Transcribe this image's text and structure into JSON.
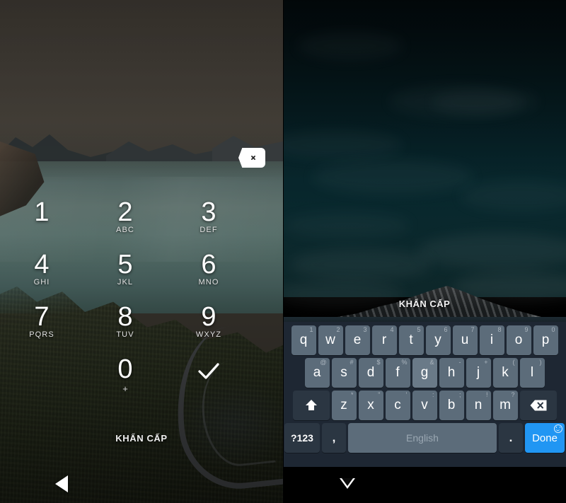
{
  "screen_left": {
    "name": "pin-lockscreen",
    "delete_key": {
      "icon": "backspace-icon",
      "label": ""
    },
    "keypad": [
      {
        "digit": "1",
        "letters": ""
      },
      {
        "digit": "2",
        "letters": "ABC"
      },
      {
        "digit": "3",
        "letters": "DEF"
      },
      {
        "digit": "4",
        "letters": "GHI"
      },
      {
        "digit": "5",
        "letters": "JKL"
      },
      {
        "digit": "6",
        "letters": "MNO"
      },
      {
        "digit": "7",
        "letters": "PQRS"
      },
      {
        "digit": "8",
        "letters": "TUV"
      },
      {
        "digit": "9",
        "letters": "WXYZ"
      },
      {
        "digit": "0",
        "letters": "+"
      }
    ],
    "enter_icon": "checkmark-icon",
    "emergency_label": "KHẨN CẤP",
    "nav_back_icon": "back-triangle-icon"
  },
  "screen_right": {
    "name": "password-lockscreen",
    "keyboard_toggle_icon": "keyboard-icon",
    "password_field": {
      "value": "",
      "placeholder": ""
    },
    "emergency_label": "KHẨN CẤP",
    "nav_down_icon": "hide-keyboard-triangle-icon",
    "keyboard": {
      "language_label": "English",
      "row1": [
        {
          "label": "q",
          "sup": "1"
        },
        {
          "label": "w",
          "sup": "2"
        },
        {
          "label": "e",
          "sup": "3"
        },
        {
          "label": "r",
          "sup": "4"
        },
        {
          "label": "t",
          "sup": "5"
        },
        {
          "label": "y",
          "sup": "6"
        },
        {
          "label": "u",
          "sup": "7"
        },
        {
          "label": "i",
          "sup": "8"
        },
        {
          "label": "o",
          "sup": "9"
        },
        {
          "label": "p",
          "sup": "0"
        }
      ],
      "row2": [
        {
          "label": "a",
          "sup": "@"
        },
        {
          "label": "s",
          "sup": "#"
        },
        {
          "label": "d",
          "sup": "$"
        },
        {
          "label": "f",
          "sup": "%"
        },
        {
          "label": "g",
          "sup": "&",
          "selected": true
        },
        {
          "label": "h",
          "sup": "-"
        },
        {
          "label": "j",
          "sup": "+"
        },
        {
          "label": "k",
          "sup": "("
        },
        {
          "label": "l",
          "sup": ")"
        }
      ],
      "row3": [
        {
          "label": "z",
          "sup": "*"
        },
        {
          "label": "x",
          "sup": "\""
        },
        {
          "label": "c",
          "sup": "'"
        },
        {
          "label": "v",
          "sup": ":"
        },
        {
          "label": "b",
          "sup": ";"
        },
        {
          "label": "n",
          "sup": "!"
        },
        {
          "label": "m",
          "sup": "?"
        }
      ],
      "shift_icon": "shift-arrow-icon",
      "backspace_icon": "backspace-icon",
      "symbols_label": "?123",
      "comma_label": ",",
      "period_label": ".",
      "done_label": "Done",
      "emoji_icon": "smiley-icon"
    }
  },
  "colors": {
    "done_button": "#2196f3",
    "keyboard_bg": "#1e2733",
    "key_bg": "#5c6c7a",
    "key_dark_bg": "#2b3642",
    "keyboard_icon": "#1fbfb8"
  }
}
